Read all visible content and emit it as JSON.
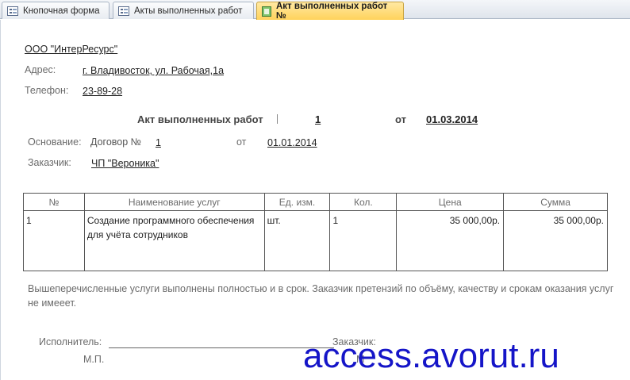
{
  "tabs": [
    {
      "label": "Кнопочная форма",
      "icon": "form-icon",
      "active": false
    },
    {
      "label": "Акты выполненных работ",
      "icon": "form-icon",
      "active": false
    },
    {
      "label": "Акт выполненных работ №",
      "icon": "report-icon",
      "active": true
    }
  ],
  "header": {
    "company": "ООО \"ИнтерРесурс\"",
    "address_label": "Адрес:",
    "address_value": "г. Владивосток, ул.  Рабочая,1а",
    "phone_label": "Телефон:",
    "phone_value": "23-89-28"
  },
  "act": {
    "title": "Акт выполненных работ",
    "number": "1",
    "date_label": "от",
    "date": "01.03.2014",
    "basis_label": "Основание:",
    "contract_label": "Договор №",
    "contract_number": "1",
    "contract_date_label": "от",
    "contract_date": "01.01.2014",
    "customer_label": "Заказчик:",
    "customer_value": "ЧП \"Вероника\""
  },
  "table": {
    "headers": [
      "№",
      "Наименование услуг",
      "Ед. изм.",
      "Кол.",
      "Цена",
      "Сумма"
    ],
    "rows": [
      {
        "num": "1",
        "service": "Создание программного обеспечения для учёта сотрудников",
        "unit": "шт.",
        "qty": "1",
        "price": "35 000,00р.",
        "sum": "35 000,00р."
      }
    ]
  },
  "note": "Вышеперечисленные услуги выполнены полностью и в срок. Заказчик претензий по объёму, качеству и срокам оказания услуг не имееет.",
  "signatures": {
    "executor_label": "Исполнитель:",
    "customer_label": "Заказчик:",
    "stamp_left": "М.П.",
    "stamp_right": "М"
  },
  "watermark": "access.avorut.ru",
  "colors": {
    "active_tab": "#ffd35b",
    "watermark": "#1515c8",
    "label_gray": "#6b6b6b"
  }
}
